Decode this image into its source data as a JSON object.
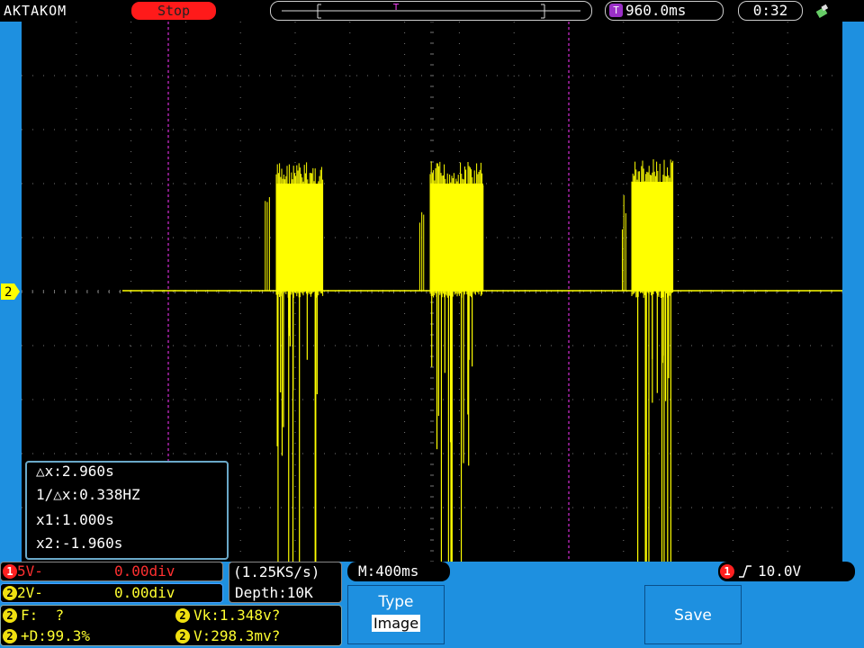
{
  "header": {
    "brand": "AKTAKOM",
    "run_state": "Stop",
    "timebase_badge": "T",
    "timebase": "960.0ms",
    "clock": "0:32"
  },
  "trace": {
    "channel_marker": "2",
    "color": "#ffff00",
    "cursor_color": "#ff33ff"
  },
  "cursor_box": {
    "dx": "△x:2.960s",
    "inv_dx": "1/△x:0.338HZ",
    "x1": "x1:1.000s",
    "x2": "x2:-1.960s"
  },
  "ch1": {
    "num": "1",
    "scale": "5V-",
    "offset": "0.00div"
  },
  "ch2": {
    "num": "2",
    "scale": "2V-",
    "offset": "0.00div"
  },
  "acquire": {
    "rate": "(1.25KS/s)",
    "depth": "Depth:10K"
  },
  "measure": {
    "num": "2",
    "f": "F:  ?",
    "d": "+D:99.3%",
    "vk": "Vk:1.348v?",
    "v": "V:298.3mv?"
  },
  "horizontal": {
    "label": "M:400ms"
  },
  "trigger": {
    "num": "1",
    "level": "10.0V"
  },
  "menu": {
    "type_label": "Type",
    "type_value": "Image",
    "save_label": "Save"
  }
}
